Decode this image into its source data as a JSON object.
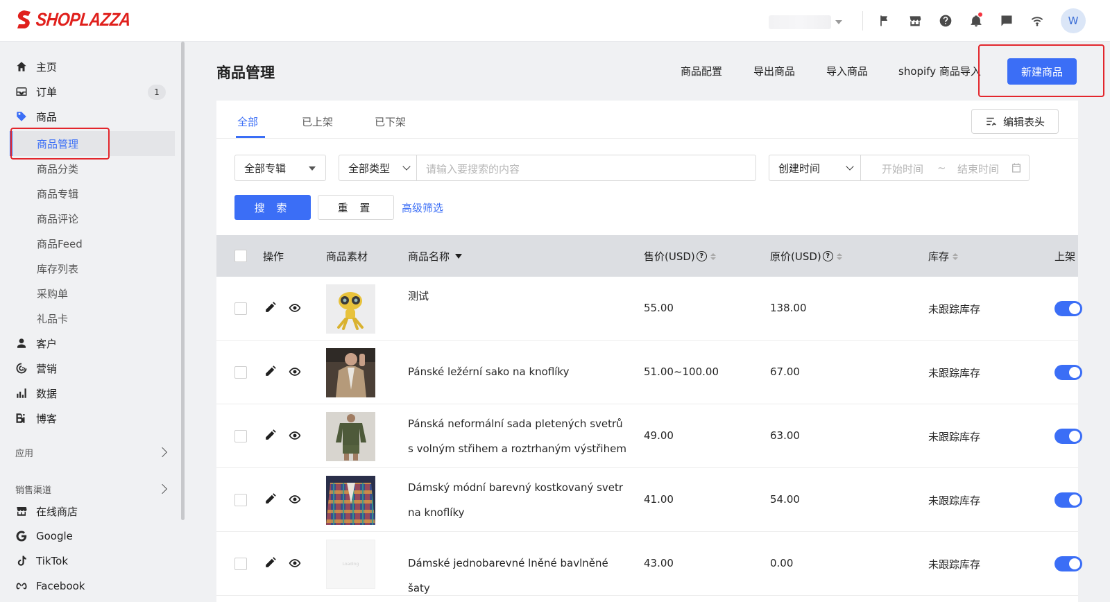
{
  "brand": {
    "name": "SHOPLAZZA",
    "color": "#e0201c"
  },
  "topbar": {
    "avatar_initial": "W",
    "icons": [
      "flag-icon",
      "store-icon",
      "help-icon",
      "bell-icon",
      "chat-icon",
      "wifi-icon"
    ]
  },
  "sidebar": {
    "items": [
      {
        "label": "主页",
        "icon": "home-icon"
      },
      {
        "label": "订单",
        "icon": "inbox-icon",
        "badge": "1"
      },
      {
        "label": "商品",
        "icon": "tag-icon"
      }
    ],
    "product_sub": [
      "商品管理",
      "商品分类",
      "商品专辑",
      "商品评论",
      "商品Feed",
      "库存列表",
      "采购单",
      "礼品卡"
    ],
    "items2": [
      {
        "label": "客户",
        "icon": "user-icon"
      },
      {
        "label": "营销",
        "icon": "marketing-icon"
      },
      {
        "label": "数据",
        "icon": "chart-icon"
      },
      {
        "label": "博客",
        "icon": "blog-icon"
      }
    ],
    "section_apps": "应用",
    "section_channels": "销售渠道",
    "channels": [
      {
        "label": "在线商店",
        "icon": "store-icon"
      },
      {
        "label": "Google",
        "icon": "google-icon"
      },
      {
        "label": "TikTok",
        "icon": "tiktok-icon"
      },
      {
        "label": "Facebook",
        "icon": "meta-icon"
      }
    ]
  },
  "header": {
    "title": "商品管理",
    "links": [
      "商品配置",
      "导出商品",
      "导入商品",
      "shopify 商品导入"
    ],
    "new_button": "新建商品"
  },
  "tabs": [
    "全部",
    "已上架",
    "已下架"
  ],
  "edit_header_button": "编辑表头",
  "filters": {
    "collection": "全部专辑",
    "type": "全部类型",
    "search_placeholder": "请输入要搜索的内容",
    "time_field": "创建时间",
    "start_placeholder": "开始时间",
    "range_sep": "~",
    "end_placeholder": "结束时间",
    "search_button": "搜 索",
    "reset_button": "重 置",
    "advanced": "高级筛选"
  },
  "table": {
    "columns": {
      "action": "操作",
      "media": "商品素材",
      "name": "商品名称",
      "price": "售价(USD)",
      "compare_price": "原价(USD)",
      "stock": "库存",
      "status": "上架"
    },
    "rows": [
      {
        "name": "测试",
        "price": "55.00",
        "compare_price": "138.00",
        "stock": "未跟踪库存",
        "thumb": "robot"
      },
      {
        "name": "Pánské ležérní sako na knoflíky",
        "price": "51.00~100.00",
        "compare_price": "67.00",
        "stock": "未跟踪库存",
        "thumb": "jacket"
      },
      {
        "name": "Pánská neformální sada pletených svetrů s volným střihem a roztrhaným výstřihem",
        "price": "49.00",
        "compare_price": "63.00",
        "stock": "未跟踪库存",
        "thumb": "sweater"
      },
      {
        "name": "Dámský módní barevný kostkovaný svetr na knoflíky",
        "price": "41.00",
        "compare_price": "54.00",
        "stock": "未跟踪库存",
        "thumb": "plaid"
      },
      {
        "name": "Dámské jednobarevné lněné bavlněné šaty",
        "price": "43.00",
        "compare_price": "0.00",
        "stock": "未跟踪库存",
        "thumb": "loading",
        "thumb_text": "Loading"
      }
    ]
  },
  "accent_color": "#3b6ef6"
}
